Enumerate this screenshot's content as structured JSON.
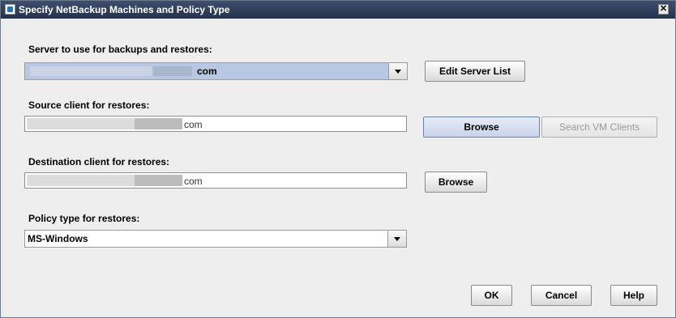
{
  "window": {
    "title": "Specify NetBackup Machines and Policy Type",
    "close_glyph": "✕"
  },
  "server": {
    "label": "Server to use for backups and restores:",
    "value": "com",
    "edit_button": "Edit Server List"
  },
  "source": {
    "label": "Source client for restores:",
    "value": "com",
    "browse_button": "Browse",
    "search_button": "Search VM Clients"
  },
  "destination": {
    "label": "Destination client for restores:",
    "value": "com",
    "browse_button": "Browse"
  },
  "policy": {
    "label": "Policy type for restores:",
    "value": "MS-Windows"
  },
  "footer": {
    "ok": "OK",
    "cancel": "Cancel",
    "help": "Help"
  },
  "colors": {
    "title_bar": "#2f3c5a",
    "selected_combo": "#b8c8e4",
    "dialog_bg": "#eeeeee"
  }
}
